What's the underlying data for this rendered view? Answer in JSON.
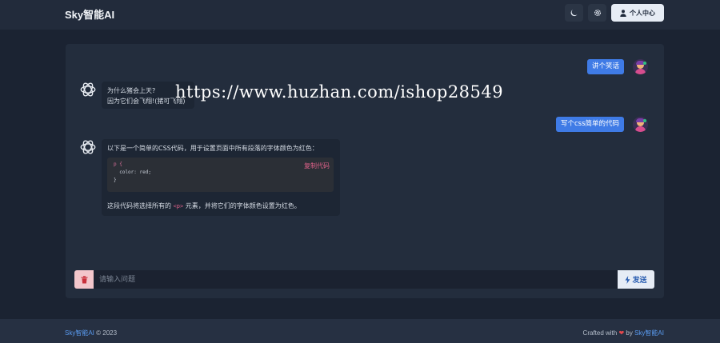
{
  "header": {
    "brand": "Sky智能AI",
    "theme_icon": "moon-icon",
    "settings_icon": "gear-icon",
    "profile_label": "个人中心"
  },
  "chat": {
    "messages": [
      {
        "role": "user",
        "text": "讲个笑话"
      },
      {
        "role": "assistant",
        "lines": [
          "为什么猪会上天?",
          "因为它们会飞翔!(猪可飞翔)"
        ]
      },
      {
        "role": "user",
        "text": "写个css简单的代码"
      },
      {
        "role": "assistant",
        "intro": "以下是一个简单的CSS代码，用于设置页面中所有段落的字体颜色为红色：",
        "code_lines": [
          "p {",
          "  color: red;",
          "}"
        ],
        "copy_label": "复制代码",
        "outro_before": "这段代码将选择所有的 ",
        "outro_code": "<p>",
        "outro_after": " 元素，并将它们的字体颜色设置为红色。"
      }
    ]
  },
  "composer": {
    "placeholder": "请输入问题",
    "send_label": "发送",
    "clear_icon": "trash-icon"
  },
  "footer": {
    "brand": "Sky智能AI",
    "copyright": "© 2023",
    "crafted_prefix": "Crafted with",
    "crafted_by": "by",
    "crafted_brand": "Sky智能AI"
  },
  "watermark": "https://www.huzhan.com/ishop28549",
  "colors": {
    "background": "#1b2332",
    "panel": "#232d3d",
    "user_bubble": "#3f7be6",
    "accent": "#5a9bf0",
    "code_accent": "#e0628a"
  }
}
